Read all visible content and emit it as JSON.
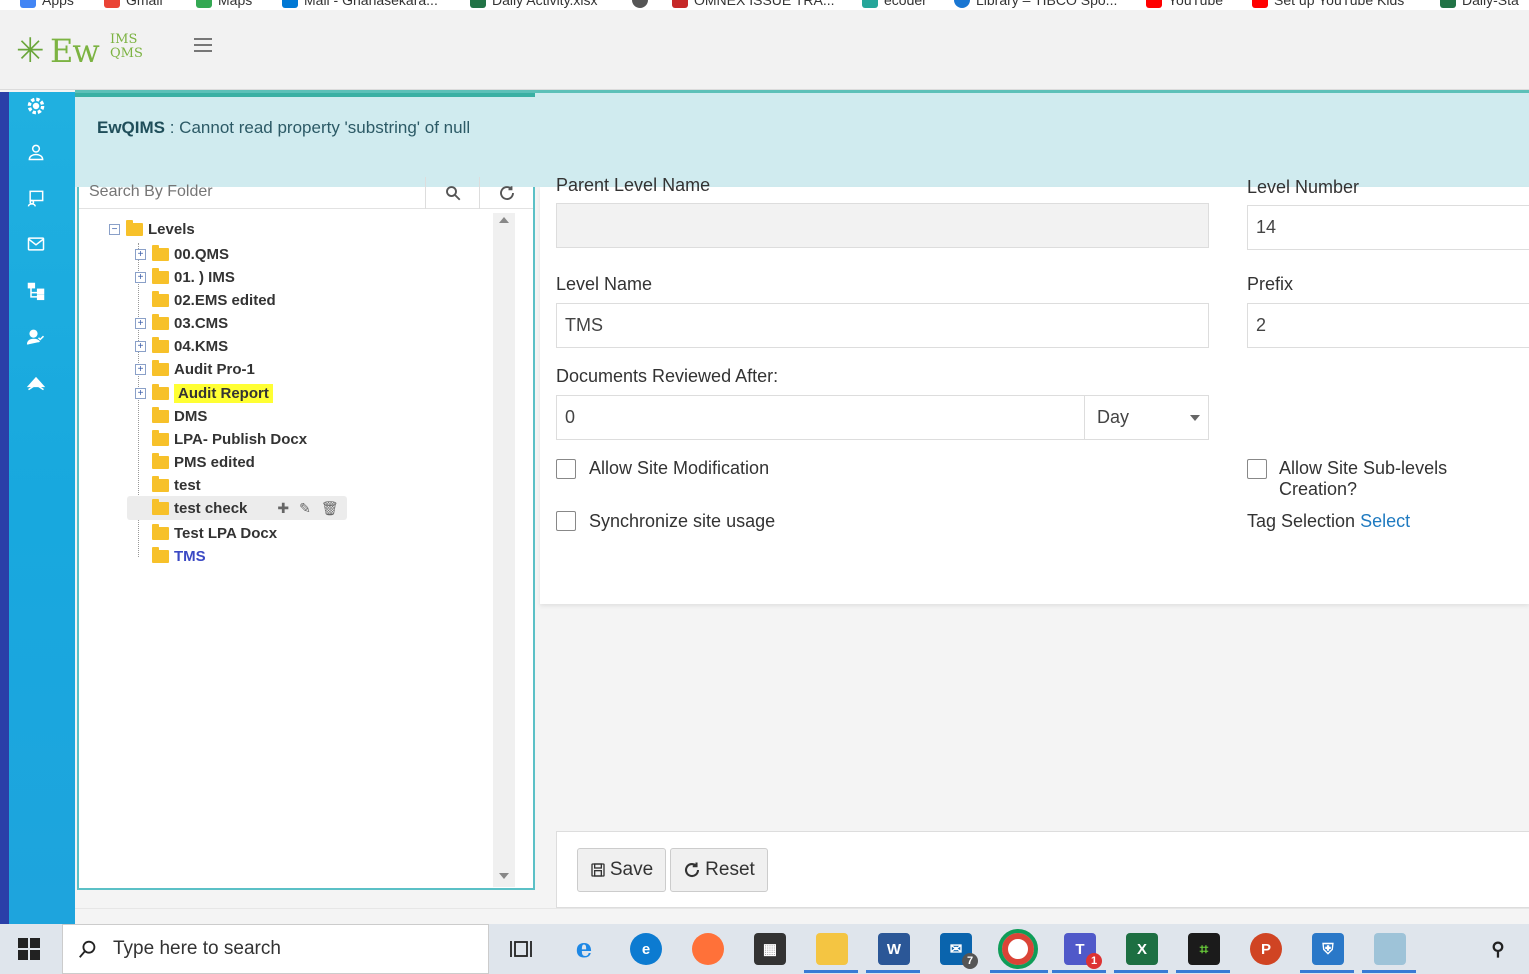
{
  "bookmarks": [
    {
      "label": "Apps",
      "color": "#4285f4"
    },
    {
      "label": "Gmail",
      "color": "#ea4335"
    },
    {
      "label": "Maps",
      "color": "#34a853"
    },
    {
      "label": "Mail - Gnanasekara...",
      "color": "#0078d4"
    },
    {
      "label": "Daily Activity.xlsx",
      "color": "#217346"
    },
    {
      "label": "",
      "color": "#555555"
    },
    {
      "label": "OMNEX ISSUE TRA...",
      "color": "#c62828"
    },
    {
      "label": "ecoder",
      "color": "#26a69a"
    },
    {
      "label": "Library – TIBCO Spo...",
      "color": "#1976d2"
    },
    {
      "label": "YouTube",
      "color": "#ff0000"
    },
    {
      "label": "Set up YouTube Kids",
      "color": "#ff0000"
    },
    {
      "label": "Daily-Sta",
      "color": "#217346"
    }
  ],
  "header": {
    "logo_ew": "Ew",
    "logo_ims": "IMS",
    "logo_qms": "QMS"
  },
  "toast": {
    "title": "EwQIMS",
    "message": " : Cannot read property 'substring' of null"
  },
  "tree": {
    "search_placeholder": "Search By Folder",
    "root_label": "Levels",
    "items": [
      {
        "label": "00.QMS",
        "expandable": true
      },
      {
        "label": "01. ) IMS",
        "expandable": true
      },
      {
        "label": "02.EMS edited",
        "expandable": false
      },
      {
        "label": "03.CMS",
        "expandable": true
      },
      {
        "label": "04.KMS",
        "expandable": true
      },
      {
        "label": "Audit Pro-1",
        "expandable": true
      },
      {
        "label": "Audit Report",
        "expandable": true
      },
      {
        "label": "DMS",
        "expandable": false
      },
      {
        "label": "LPA- Publish Docx",
        "expandable": false
      },
      {
        "label": "PMS edited",
        "expandable": false
      },
      {
        "label": "test",
        "expandable": false
      },
      {
        "label": "test check",
        "expandable": false
      },
      {
        "label": "Test LPA Docx",
        "expandable": false
      },
      {
        "label": "TMS",
        "expandable": false
      }
    ]
  },
  "form": {
    "parent_level_label": "Parent Level Name",
    "parent_level_value": "",
    "level_number_label": "Level Number",
    "level_number_value": "14",
    "level_name_label": "Level Name",
    "level_name_value": "TMS",
    "prefix_label": "Prefix",
    "prefix_value": "2",
    "reviewed_after_label": "Documents Reviewed After:",
    "reviewed_after_value": "0",
    "reviewed_unit": "Day",
    "allow_site_mod_label": "Allow Site Modification",
    "allow_sublevels_label": "Allow Site Sub-levels Creation?",
    "sync_site_label": "Synchronize site usage",
    "tag_selection_label": "Tag Selection",
    "tag_selection_link": "Select"
  },
  "footer": {
    "save_label": "Save",
    "reset_label": "Reset"
  },
  "taskbar": {
    "search_text": "Type here to search",
    "mail_badge": "7",
    "teams_badge": "1"
  },
  "colors": {
    "rail": "#1ea4dd",
    "toast_bg": "#d0ebef",
    "highlight": "#ffff33",
    "active_item": "#3b49c4",
    "link": "#1f7ac0"
  }
}
